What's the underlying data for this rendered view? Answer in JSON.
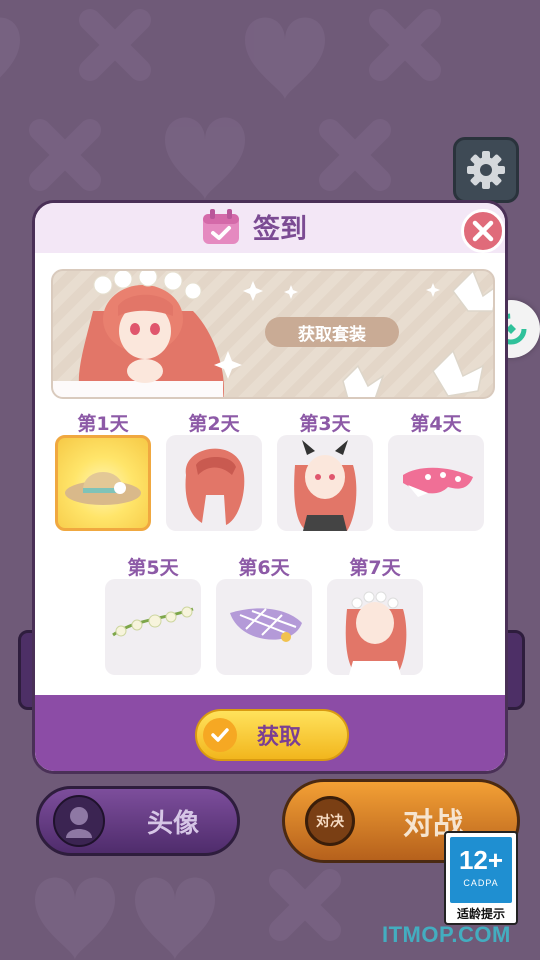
{
  "modal": {
    "title": "签到",
    "banner_button": "获取套装",
    "claim_button": "获取",
    "days": [
      {
        "label": "第1天",
        "item": "straw-hat",
        "active": true
      },
      {
        "label": "第2天",
        "item": "red-hair",
        "active": false
      },
      {
        "label": "第3天",
        "item": "character-portrait",
        "active": false
      },
      {
        "label": "第4天",
        "item": "pink-accessory",
        "active": false
      },
      {
        "label": "第5天",
        "item": "flower-crown",
        "active": false
      },
      {
        "label": "第6天",
        "item": "purple-hat",
        "active": false
      },
      {
        "label": "第7天",
        "item": "character-portrait",
        "active": false
      }
    ]
  },
  "bottom": {
    "avatar_label": "头像",
    "battle_badge": "对决",
    "battle_label": "对战"
  },
  "age_rating": {
    "number": "12+",
    "org": "CADPA",
    "text": "适龄提示"
  },
  "watermark": "ITMOP.COM",
  "colors": {
    "background": "#6f5a78",
    "accent_purple": "#8c4ca6",
    "title_purple": "#7b4b93",
    "close_red": "#e06b7a",
    "claim_yellow": "#f2b61d"
  }
}
